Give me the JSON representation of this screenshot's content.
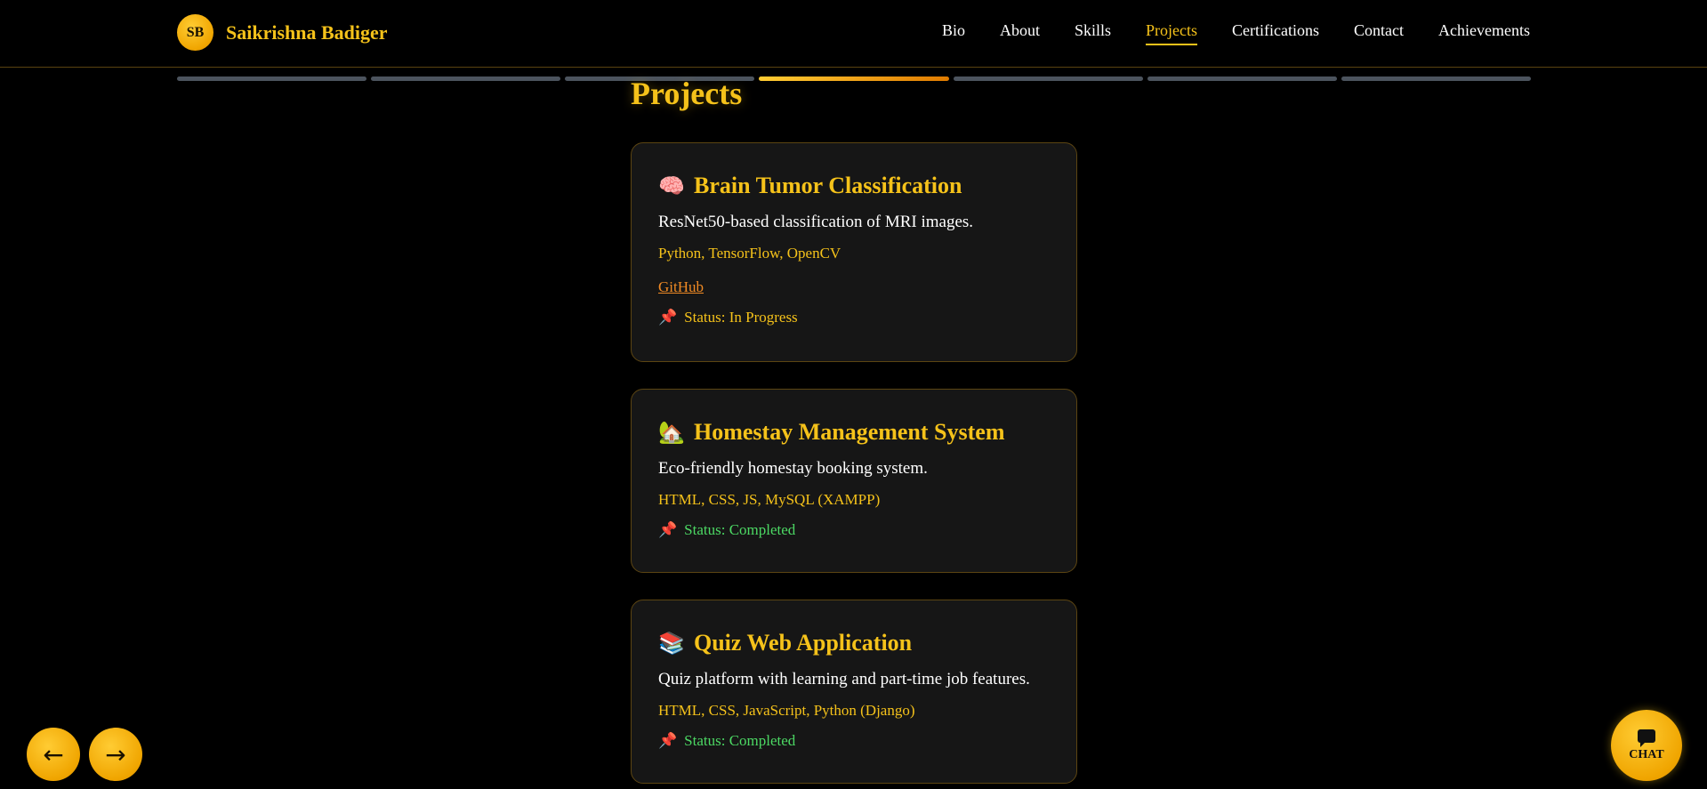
{
  "header": {
    "logo_initials": "SB",
    "brand_name": "Saikrishna Badiger",
    "nav": [
      {
        "label": "Bio"
      },
      {
        "label": "About"
      },
      {
        "label": "Skills"
      },
      {
        "label": "Projects"
      },
      {
        "label": "Certifications"
      },
      {
        "label": "Contact"
      },
      {
        "label": "Achievements"
      }
    ],
    "active_nav": "Projects"
  },
  "progress": {
    "segments": 7,
    "active_index": 3
  },
  "section": {
    "title": "Projects"
  },
  "projects": [
    {
      "icon": "brain-icon",
      "emoji": "🧠",
      "title": "Brain Tumor Classification",
      "description": "ResNet50-based classification of MRI images.",
      "tech": "Python, TensorFlow, OpenCV",
      "link_label": "GitHub",
      "status": "Status: In Progress"
    },
    {
      "icon": "house-icon",
      "emoji": "🏡",
      "title": "Homestay Management System",
      "description": "Eco-friendly homestay booking system.",
      "tech": "HTML, CSS, JS, MySQL (XAMPP)",
      "status": "Status: Completed"
    },
    {
      "icon": "books-icon",
      "emoji": "📚",
      "title": "Quiz Web Application",
      "description": "Quiz platform with learning and part-time job features.",
      "tech": "HTML, CSS, JavaScript, Python (Django)",
      "status": "Status: Completed"
    }
  ],
  "controls": {
    "prev_glyph": "←",
    "next_glyph": "→",
    "chat_label": "CHAT"
  },
  "colors": {
    "accent": "#f5c21a",
    "link": "#f08a24",
    "completed": "#4cd964",
    "background": "#000000",
    "card": "#161616"
  }
}
